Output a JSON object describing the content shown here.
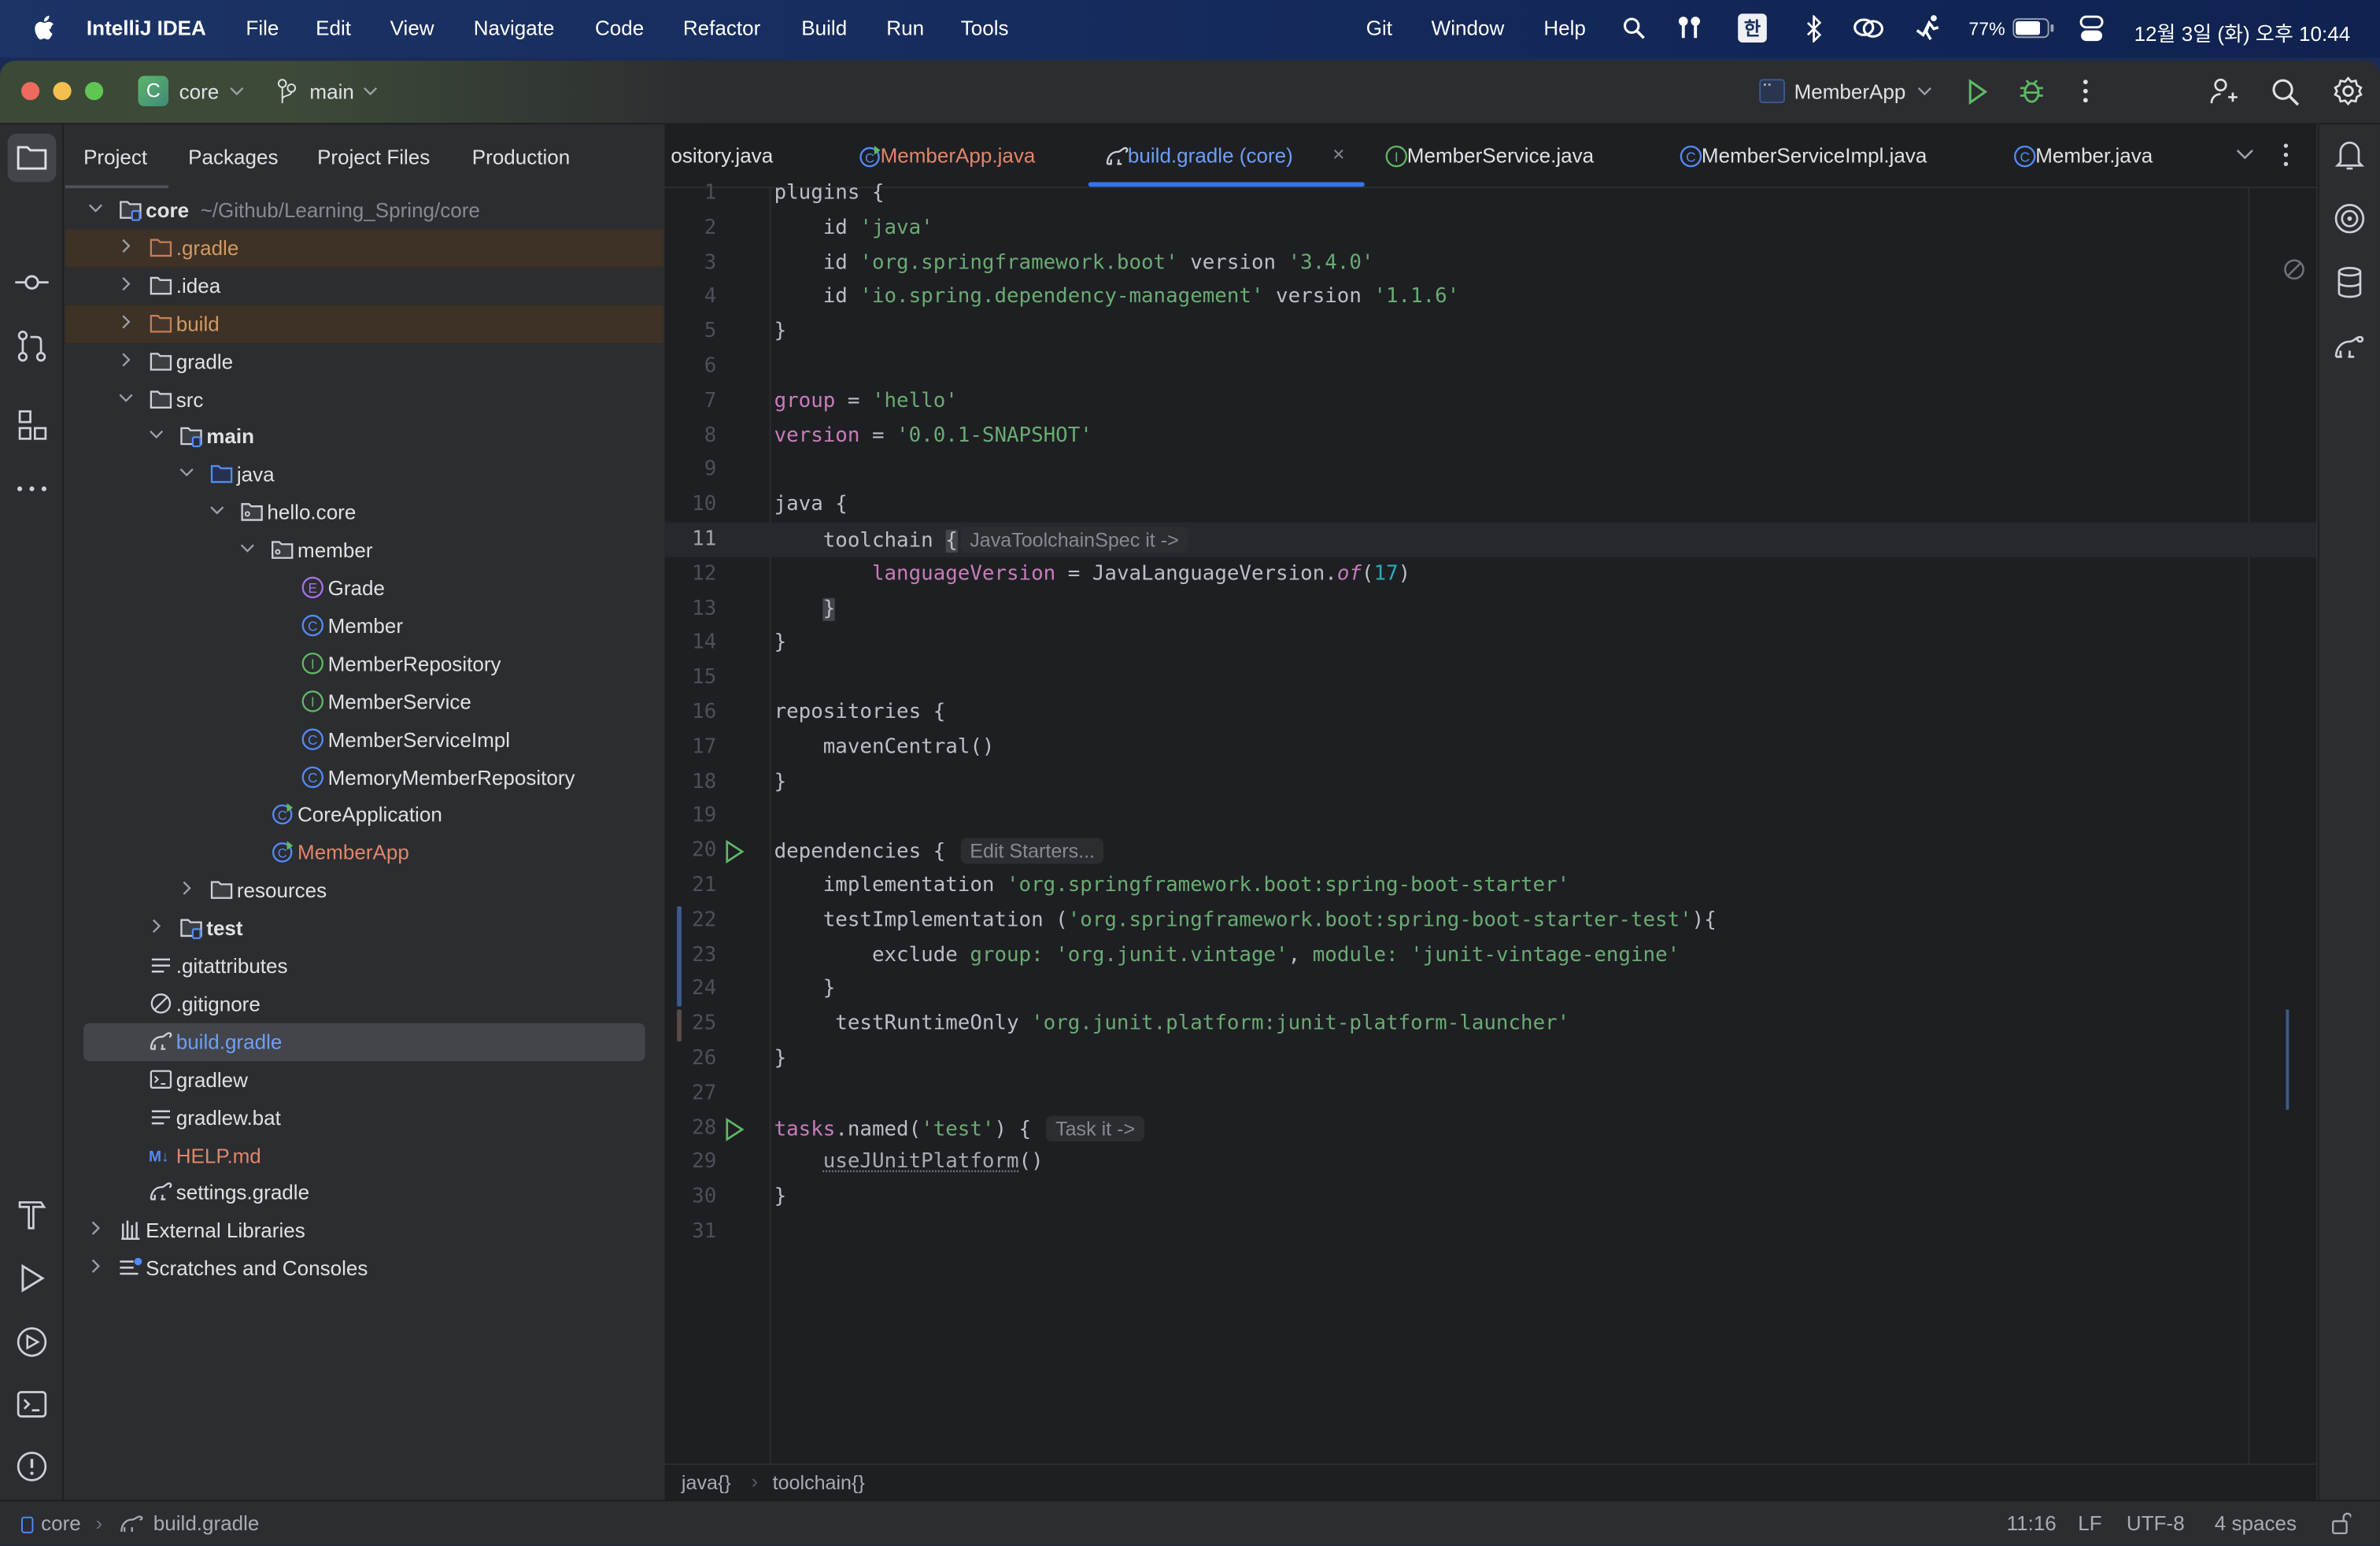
{
  "menubar": {
    "app_name": "IntelliJ IDEA",
    "items": [
      "File",
      "Edit",
      "View",
      "Navigate",
      "Code",
      "Refactor",
      "Build",
      "Run",
      "Tools"
    ],
    "right_items": [
      "Git",
      "Window",
      "Help"
    ],
    "input_method": "한",
    "battery": "77%",
    "clock": "12월 3일 (화) 오후 10:44"
  },
  "titlebar": {
    "project_badge": "C",
    "project_name": "core",
    "branch": "main",
    "run_config": "MemberApp"
  },
  "project_panel": {
    "tabs": [
      "Project",
      "Packages",
      "Project Files",
      "Production"
    ],
    "root_path": "~/Github/Learning_Spring/core",
    "tree": [
      {
        "label": "core",
        "depth": 0,
        "chevron": "down",
        "icon": "module-folder",
        "bold": true
      },
      {
        "label": ".gradle",
        "depth": 1,
        "chevron": "right",
        "icon": "folder-excluded",
        "excluded": true
      },
      {
        "label": ".idea",
        "depth": 1,
        "chevron": "right",
        "icon": "folder"
      },
      {
        "label": "build",
        "depth": 1,
        "chevron": "right",
        "icon": "folder-excluded",
        "excluded": true
      },
      {
        "label": "gradle",
        "depth": 1,
        "chevron": "right",
        "icon": "folder"
      },
      {
        "label": "src",
        "depth": 1,
        "chevron": "down",
        "icon": "folder"
      },
      {
        "label": "main",
        "depth": 2,
        "chevron": "down",
        "icon": "module-folder",
        "bold": true
      },
      {
        "label": "java",
        "depth": 3,
        "chevron": "down",
        "icon": "source-folder"
      },
      {
        "label": "hello.core",
        "depth": 4,
        "chevron": "down",
        "icon": "package"
      },
      {
        "label": "member",
        "depth": 5,
        "chevron": "down",
        "icon": "package"
      },
      {
        "label": "Grade",
        "depth": 6,
        "icon": "enum"
      },
      {
        "label": "Member",
        "depth": 6,
        "icon": "class"
      },
      {
        "label": "MemberRepository",
        "depth": 6,
        "icon": "interface"
      },
      {
        "label": "MemberService",
        "depth": 6,
        "icon": "interface"
      },
      {
        "label": "MemberServiceImpl",
        "depth": 6,
        "icon": "class"
      },
      {
        "label": "MemoryMemberRepository",
        "depth": 6,
        "icon": "class"
      },
      {
        "label": "CoreApplication",
        "depth": 5,
        "icon": "spring-class"
      },
      {
        "label": "MemberApp",
        "depth": 5,
        "icon": "spring-class",
        "modified": true
      },
      {
        "label": "resources",
        "depth": 3,
        "chevron": "right",
        "icon": "resources-folder"
      },
      {
        "label": "test",
        "depth": 2,
        "chevron": "right",
        "icon": "module-folder",
        "bold": true
      },
      {
        "label": ".gitattributes",
        "depth": 1,
        "icon": "text-file"
      },
      {
        "label": ".gitignore",
        "depth": 1,
        "icon": "gitignore"
      },
      {
        "label": "build.gradle",
        "depth": 1,
        "icon": "gradle",
        "selected": true
      },
      {
        "label": "gradlew",
        "depth": 1,
        "icon": "terminal-file"
      },
      {
        "label": "gradlew.bat",
        "depth": 1,
        "icon": "text-file"
      },
      {
        "label": "HELP.md",
        "depth": 1,
        "icon": "markdown",
        "modified": true
      },
      {
        "label": "settings.gradle",
        "depth": 1,
        "icon": "gradle"
      },
      {
        "label": "External Libraries",
        "depth": 0,
        "chevron": "right",
        "icon": "library"
      },
      {
        "label": "Scratches and Consoles",
        "depth": 0,
        "chevron": "right",
        "icon": "scratches"
      }
    ]
  },
  "editor": {
    "tabs": [
      {
        "label": "ository.java",
        "icon": "none"
      },
      {
        "label": "MemberApp.java",
        "icon": "spring-class",
        "modified": true
      },
      {
        "label": "build.gradle (core)",
        "icon": "gradle",
        "active": true,
        "closable": true
      },
      {
        "label": "MemberService.java",
        "icon": "interface"
      },
      {
        "label": "MemberServiceImpl.java",
        "icon": "class"
      },
      {
        "label": "Member.java",
        "icon": "class"
      }
    ],
    "current_line": 11,
    "lines": [
      [
        [
          "plugins {",
          ""
        ]
      ],
      [
        [
          "    id ",
          ""
        ],
        [
          "'java'",
          "str"
        ]
      ],
      [
        [
          "    id ",
          ""
        ],
        [
          "'org.springframework.boot'",
          "str"
        ],
        [
          " version ",
          ""
        ],
        [
          "'3.4.0'",
          "str"
        ]
      ],
      [
        [
          "    id ",
          ""
        ],
        [
          "'io.spring.dependency-management'",
          "str"
        ],
        [
          " version ",
          ""
        ],
        [
          "'1.1.6'",
          "str"
        ]
      ],
      [
        [
          "}",
          ""
        ]
      ],
      [],
      [
        [
          "group",
          "prop"
        ],
        [
          " = ",
          ""
        ],
        [
          "'hello'",
          "str"
        ]
      ],
      [
        [
          "version",
          "prop"
        ],
        [
          " = ",
          ""
        ],
        [
          "'0.0.1-SNAPSHOT'",
          "str"
        ]
      ],
      [],
      [
        [
          "java {",
          ""
        ]
      ],
      [
        [
          "    toolchain ",
          ""
        ],
        [
          "{",
          "brace"
        ],
        [
          "JavaToolchainSpec it ->",
          "hint"
        ]
      ],
      [
        [
          "        ",
          ""
        ],
        [
          "languageVersion",
          "prop"
        ],
        [
          " = JavaLanguageVersion.",
          ""
        ],
        [
          "of",
          "it"
        ],
        [
          "(",
          ""
        ],
        [
          "17",
          "num"
        ],
        [
          ")",
          ""
        ]
      ],
      [
        [
          "    ",
          ""
        ],
        [
          "}",
          "brace"
        ]
      ],
      [
        [
          "}",
          ""
        ]
      ],
      [],
      [
        [
          "repositories {",
          ""
        ]
      ],
      [
        [
          "    mavenCentral()",
          ""
        ]
      ],
      [
        [
          "}",
          ""
        ]
      ],
      [],
      [
        [
          "dependencies { ",
          ""
        ],
        [
          "Edit Starters...",
          "hint"
        ]
      ],
      [
        [
          "    implementation ",
          ""
        ],
        [
          "'org.springframework.boot:spring-boot-starter'",
          "str"
        ]
      ],
      [
        [
          "    testImplementation (",
          ""
        ],
        [
          "'org.springframework.boot:spring-boot-starter-test'",
          "str"
        ],
        [
          "){",
          ""
        ]
      ],
      [
        [
          "        exclude ",
          ""
        ],
        [
          "group: ",
          "str"
        ],
        [
          "'org.junit.vintage'",
          "str"
        ],
        [
          ", ",
          ""
        ],
        [
          "module: ",
          "str"
        ],
        [
          "'junit-vintage-engine'",
          "str"
        ]
      ],
      [
        [
          "    }",
          ""
        ]
      ],
      [
        [
          "     testRuntimeOnly ",
          ""
        ],
        [
          "'org.junit.platform:junit-platform-launcher'",
          "str"
        ]
      ],
      [
        [
          "}",
          ""
        ]
      ],
      [],
      [
        [
          "tasks",
          "prop"
        ],
        [
          ".named(",
          ""
        ],
        [
          "'test'",
          "str"
        ],
        [
          ") { ",
          ""
        ],
        [
          "Task it ->",
          "hint"
        ]
      ],
      [
        [
          "    ",
          ""
        ],
        [
          "useJUnitPlatform",
          "dep"
        ],
        [
          "()",
          ""
        ]
      ],
      [
        [
          "}",
          ""
        ]
      ],
      []
    ],
    "run_gutter_lines": [
      20,
      28
    ],
    "breadcrumbs": [
      "java{}",
      "toolchain{}"
    ]
  },
  "statusbar": {
    "path": [
      "core",
      "build.gradle"
    ],
    "position": "11:16",
    "line_separator": "LF",
    "encoding": "UTF-8",
    "indent": "4 spaces"
  },
  "colors": {
    "accent": "#3574f0",
    "string": "#6aab73",
    "property": "#c77dbb",
    "number": "#2aacb8",
    "excluded": "#d19a66",
    "modified": "#e0866a"
  }
}
